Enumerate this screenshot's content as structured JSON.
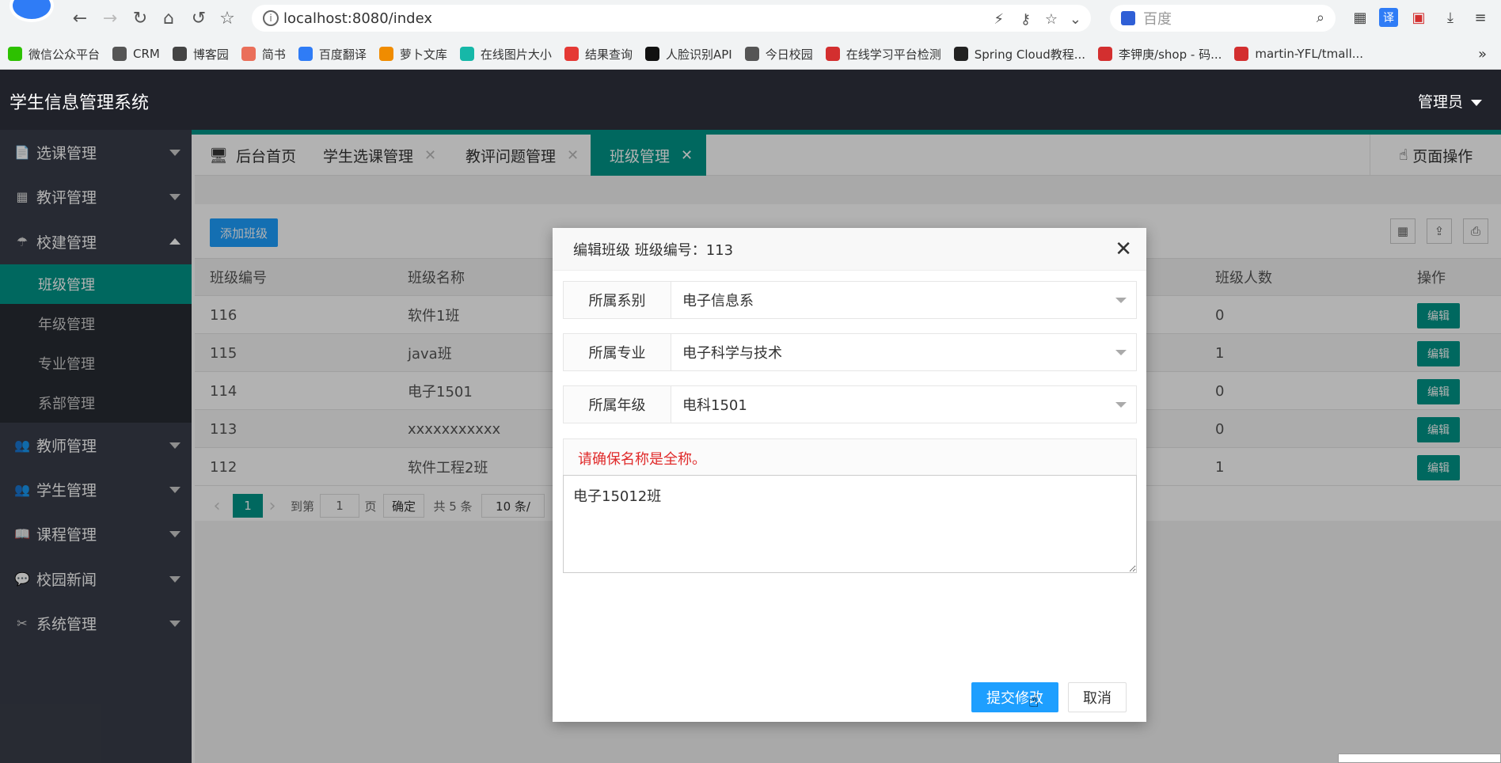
{
  "browser": {
    "url": "localhost:8080/index",
    "search_placeholder": "百度",
    "bookmarks": [
      {
        "label": "微信公众平台",
        "color": "#2dc100"
      },
      {
        "label": "CRM",
        "color": "#555555"
      },
      {
        "label": "博客园",
        "color": "#444444"
      },
      {
        "label": "简书",
        "color": "#ea6f5a"
      },
      {
        "label": "百度翻译",
        "color": "#2f7cf6"
      },
      {
        "label": "萝卜文库",
        "color": "#f08c00"
      },
      {
        "label": "在线图片大小",
        "color": "#16b8a8"
      },
      {
        "label": "结果查询",
        "color": "#e53935"
      },
      {
        "label": "人脸识别API",
        "color": "#111111"
      },
      {
        "label": "今日校园",
        "color": "#555555"
      },
      {
        "label": "在线学习平台检测",
        "color": "#d32f2f"
      },
      {
        "label": "Spring Cloud教程...",
        "color": "#222222"
      },
      {
        "label": "李钾庚/shop - 码...",
        "color": "#d32f2f"
      },
      {
        "label": "martin-YFL/tmall...",
        "color": "#d32f2f"
      }
    ],
    "more_bookmarks": "»"
  },
  "app": {
    "title": "学生信息管理系统",
    "user_menu": "管理员"
  },
  "sidebar": {
    "items": [
      {
        "label": "选课管理",
        "icon": "📄"
      },
      {
        "label": "教评管理",
        "icon": "▦"
      },
      {
        "label": "校建管理",
        "icon": "☂"
      },
      {
        "label": "教师管理",
        "icon": "👥"
      },
      {
        "label": "学生管理",
        "icon": "👥"
      },
      {
        "label": "课程管理",
        "icon": "📖"
      },
      {
        "label": "校园新闻",
        "icon": "💬"
      },
      {
        "label": "系统管理",
        "icon": "✂"
      }
    ],
    "sub_items": [
      "班级管理",
      "年级管理",
      "专业管理",
      "系部管理"
    ]
  },
  "tabs": {
    "home": "后台首页",
    "items": [
      "学生选课管理",
      "教评问题管理",
      "班级管理"
    ],
    "close_glyph": "✕",
    "page_ops": "页面操作"
  },
  "toolbar": {
    "add_class": "添加班级"
  },
  "table": {
    "headers": [
      "班级编号",
      "班级名称",
      "班级人数",
      "操作"
    ],
    "rows": [
      {
        "id": "116",
        "name": "软件1班",
        "count": "0"
      },
      {
        "id": "115",
        "name": "java班",
        "count": "1"
      },
      {
        "id": "114",
        "name": "电子1501",
        "count": "0"
      },
      {
        "id": "113",
        "name": "xxxxxxxxxxx",
        "count": "0"
      },
      {
        "id": "112",
        "name": "软件工程2班",
        "count": "1"
      }
    ],
    "edit_label": "编辑"
  },
  "pager": {
    "prev": "‹",
    "current": "1",
    "next": "›",
    "goto_label": "到第",
    "goto_value": "1",
    "page_label": "页",
    "confirm": "确定",
    "total": "共 5 条",
    "per_page": "10 条/"
  },
  "dialog": {
    "title": "编辑班级 班级编号：113",
    "close": "✕",
    "dept_label": "所属系别",
    "dept_value": "电子信息系",
    "major_label": "所属专业",
    "major_value": "电子科学与技术",
    "grade_label": "所属年级",
    "grade_value": "电科1501",
    "warning": "请确保名称是全称。",
    "name_value": "电子15012班",
    "submit": "提交修改",
    "cancel": "取消"
  }
}
